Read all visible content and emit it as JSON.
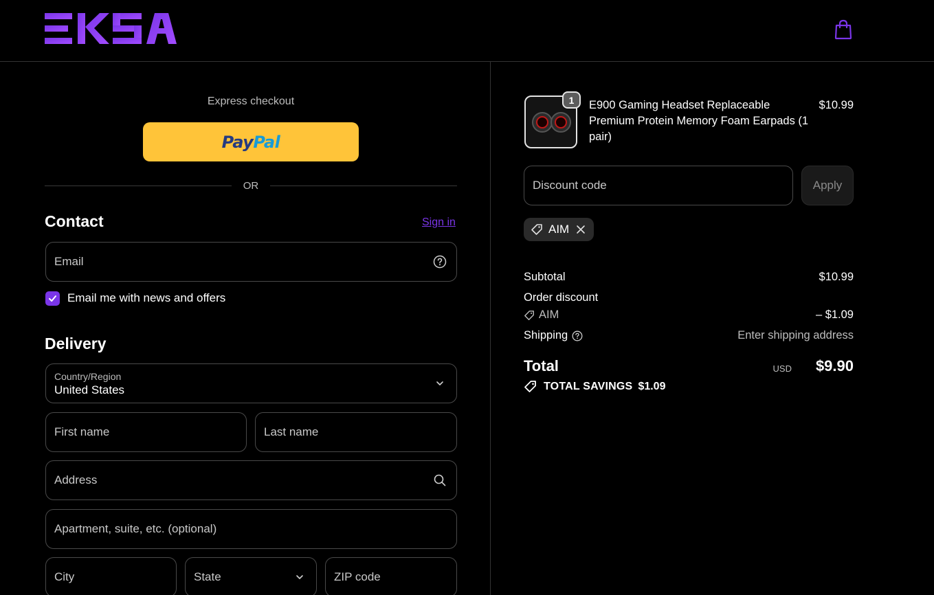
{
  "brand": {
    "name": "EKSA",
    "accent": "#7a35e8"
  },
  "express": {
    "label": "Express checkout",
    "paypal_pay": "Pay",
    "paypal_pal": "Pal",
    "or_label": "OR"
  },
  "contact": {
    "title": "Contact",
    "signin_label": "Sign in",
    "email_placeholder": "Email",
    "newsletter_label": "Email me with news and offers",
    "newsletter_checked": true
  },
  "delivery": {
    "title": "Delivery",
    "country_label": "Country/Region",
    "country_value": "United States",
    "first_name_placeholder": "First name",
    "last_name_placeholder": "Last name",
    "address_placeholder": "Address",
    "apartment_placeholder": "Apartment, suite, etc. (optional)",
    "city_placeholder": "City",
    "state_placeholder": "State",
    "zip_placeholder": "ZIP code"
  },
  "order": {
    "item": {
      "quantity": "1",
      "name": "E900 Gaming Headset Replaceable Premium Protein Memory Foam Earpads (1 pair)",
      "price": "$10.99"
    },
    "discount_placeholder": "Discount code",
    "apply_label": "Apply",
    "applied_code": "AIM",
    "subtotal_label": "Subtotal",
    "subtotal_value": "$10.99",
    "order_discount_label": "Order discount",
    "discount_code": "AIM",
    "discount_value": "– $1.09",
    "shipping_label": "Shipping",
    "shipping_value": "Enter shipping address",
    "total_label": "Total",
    "currency": "USD",
    "total_value": "$9.90",
    "savings_label": "TOTAL SAVINGS",
    "savings_value": "$1.09"
  }
}
